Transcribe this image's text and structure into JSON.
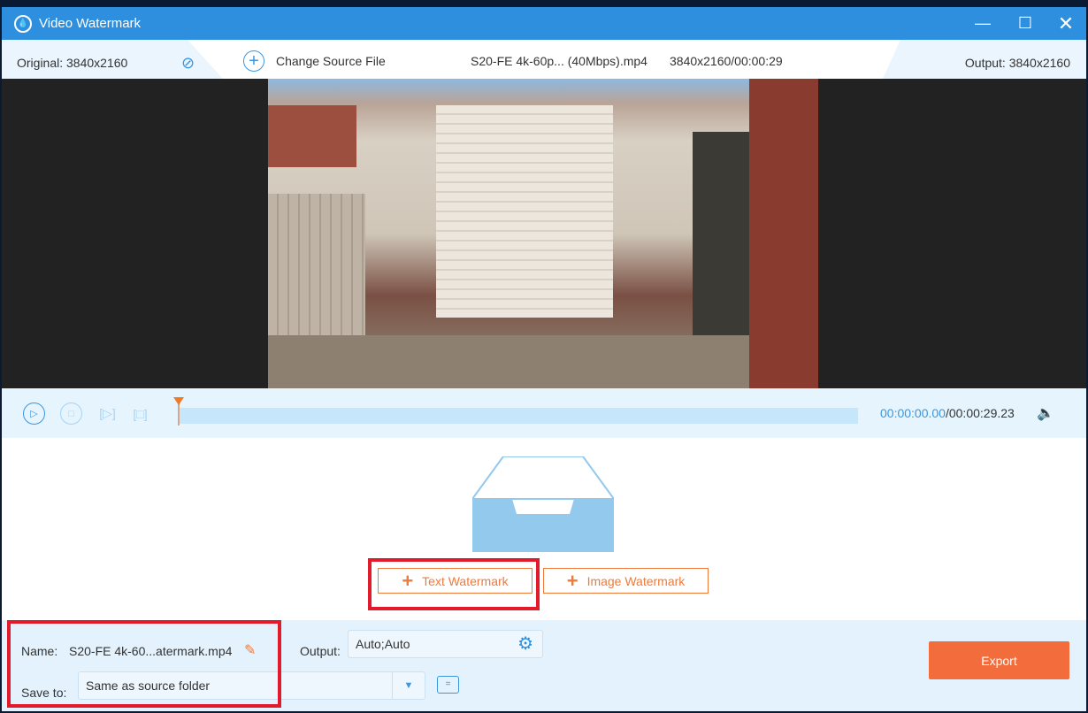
{
  "window": {
    "title": "Video Watermark"
  },
  "info": {
    "original": "Original: 3840x2160",
    "change_source": "Change Source File",
    "file_name": "S20-FE 4k-60p... (40Mbps).mp4",
    "file_meta": "3840x2160/00:00:29",
    "output": "Output: 3840x2160"
  },
  "player": {
    "current_time": "00:00:00.00",
    "total_time": "/00:00:29.23",
    "progress": 0
  },
  "watermark": {
    "text_btn": "Text Watermark",
    "image_btn": "Image Watermark"
  },
  "bottom": {
    "name_label": "Name:",
    "name_value": "S20-FE 4k-60...atermark.mp4",
    "output_label": "Output:",
    "output_value": "Auto;Auto",
    "save_label": "Save to:",
    "save_value": "Same as source folder",
    "export": "Export"
  },
  "colors": {
    "accent": "#2f8fdf",
    "orange": "#f26c3c",
    "highlight": "#e21b2c"
  }
}
